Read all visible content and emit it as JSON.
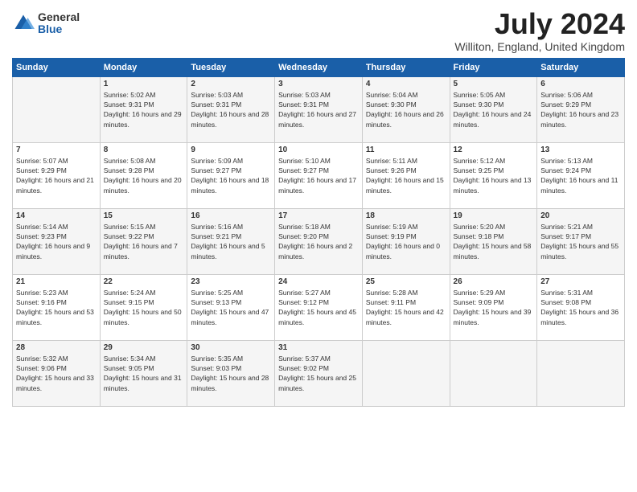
{
  "header": {
    "logo_general": "General",
    "logo_blue": "Blue",
    "month_title": "July 2024",
    "location": "Williton, England, United Kingdom"
  },
  "days_of_week": [
    "Sunday",
    "Monday",
    "Tuesday",
    "Wednesday",
    "Thursday",
    "Friday",
    "Saturday"
  ],
  "weeks": [
    [
      {
        "day": "",
        "sunrise": "",
        "sunset": "",
        "daylight": ""
      },
      {
        "day": "1",
        "sunrise": "Sunrise: 5:02 AM",
        "sunset": "Sunset: 9:31 PM",
        "daylight": "Daylight: 16 hours and 29 minutes."
      },
      {
        "day": "2",
        "sunrise": "Sunrise: 5:03 AM",
        "sunset": "Sunset: 9:31 PM",
        "daylight": "Daylight: 16 hours and 28 minutes."
      },
      {
        "day": "3",
        "sunrise": "Sunrise: 5:03 AM",
        "sunset": "Sunset: 9:31 PM",
        "daylight": "Daylight: 16 hours and 27 minutes."
      },
      {
        "day": "4",
        "sunrise": "Sunrise: 5:04 AM",
        "sunset": "Sunset: 9:30 PM",
        "daylight": "Daylight: 16 hours and 26 minutes."
      },
      {
        "day": "5",
        "sunrise": "Sunrise: 5:05 AM",
        "sunset": "Sunset: 9:30 PM",
        "daylight": "Daylight: 16 hours and 24 minutes."
      },
      {
        "day": "6",
        "sunrise": "Sunrise: 5:06 AM",
        "sunset": "Sunset: 9:29 PM",
        "daylight": "Daylight: 16 hours and 23 minutes."
      }
    ],
    [
      {
        "day": "7",
        "sunrise": "Sunrise: 5:07 AM",
        "sunset": "Sunset: 9:29 PM",
        "daylight": "Daylight: 16 hours and 21 minutes."
      },
      {
        "day": "8",
        "sunrise": "Sunrise: 5:08 AM",
        "sunset": "Sunset: 9:28 PM",
        "daylight": "Daylight: 16 hours and 20 minutes."
      },
      {
        "day": "9",
        "sunrise": "Sunrise: 5:09 AM",
        "sunset": "Sunset: 9:27 PM",
        "daylight": "Daylight: 16 hours and 18 minutes."
      },
      {
        "day": "10",
        "sunrise": "Sunrise: 5:10 AM",
        "sunset": "Sunset: 9:27 PM",
        "daylight": "Daylight: 16 hours and 17 minutes."
      },
      {
        "day": "11",
        "sunrise": "Sunrise: 5:11 AM",
        "sunset": "Sunset: 9:26 PM",
        "daylight": "Daylight: 16 hours and 15 minutes."
      },
      {
        "day": "12",
        "sunrise": "Sunrise: 5:12 AM",
        "sunset": "Sunset: 9:25 PM",
        "daylight": "Daylight: 16 hours and 13 minutes."
      },
      {
        "day": "13",
        "sunrise": "Sunrise: 5:13 AM",
        "sunset": "Sunset: 9:24 PM",
        "daylight": "Daylight: 16 hours and 11 minutes."
      }
    ],
    [
      {
        "day": "14",
        "sunrise": "Sunrise: 5:14 AM",
        "sunset": "Sunset: 9:23 PM",
        "daylight": "Daylight: 16 hours and 9 minutes."
      },
      {
        "day": "15",
        "sunrise": "Sunrise: 5:15 AM",
        "sunset": "Sunset: 9:22 PM",
        "daylight": "Daylight: 16 hours and 7 minutes."
      },
      {
        "day": "16",
        "sunrise": "Sunrise: 5:16 AM",
        "sunset": "Sunset: 9:21 PM",
        "daylight": "Daylight: 16 hours and 5 minutes."
      },
      {
        "day": "17",
        "sunrise": "Sunrise: 5:18 AM",
        "sunset": "Sunset: 9:20 PM",
        "daylight": "Daylight: 16 hours and 2 minutes."
      },
      {
        "day": "18",
        "sunrise": "Sunrise: 5:19 AM",
        "sunset": "Sunset: 9:19 PM",
        "daylight": "Daylight: 16 hours and 0 minutes."
      },
      {
        "day": "19",
        "sunrise": "Sunrise: 5:20 AM",
        "sunset": "Sunset: 9:18 PM",
        "daylight": "Daylight: 15 hours and 58 minutes."
      },
      {
        "day": "20",
        "sunrise": "Sunrise: 5:21 AM",
        "sunset": "Sunset: 9:17 PM",
        "daylight": "Daylight: 15 hours and 55 minutes."
      }
    ],
    [
      {
        "day": "21",
        "sunrise": "Sunrise: 5:23 AM",
        "sunset": "Sunset: 9:16 PM",
        "daylight": "Daylight: 15 hours and 53 minutes."
      },
      {
        "day": "22",
        "sunrise": "Sunrise: 5:24 AM",
        "sunset": "Sunset: 9:15 PM",
        "daylight": "Daylight: 15 hours and 50 minutes."
      },
      {
        "day": "23",
        "sunrise": "Sunrise: 5:25 AM",
        "sunset": "Sunset: 9:13 PM",
        "daylight": "Daylight: 15 hours and 47 minutes."
      },
      {
        "day": "24",
        "sunrise": "Sunrise: 5:27 AM",
        "sunset": "Sunset: 9:12 PM",
        "daylight": "Daylight: 15 hours and 45 minutes."
      },
      {
        "day": "25",
        "sunrise": "Sunrise: 5:28 AM",
        "sunset": "Sunset: 9:11 PM",
        "daylight": "Daylight: 15 hours and 42 minutes."
      },
      {
        "day": "26",
        "sunrise": "Sunrise: 5:29 AM",
        "sunset": "Sunset: 9:09 PM",
        "daylight": "Daylight: 15 hours and 39 minutes."
      },
      {
        "day": "27",
        "sunrise": "Sunrise: 5:31 AM",
        "sunset": "Sunset: 9:08 PM",
        "daylight": "Daylight: 15 hours and 36 minutes."
      }
    ],
    [
      {
        "day": "28",
        "sunrise": "Sunrise: 5:32 AM",
        "sunset": "Sunset: 9:06 PM",
        "daylight": "Daylight: 15 hours and 33 minutes."
      },
      {
        "day": "29",
        "sunrise": "Sunrise: 5:34 AM",
        "sunset": "Sunset: 9:05 PM",
        "daylight": "Daylight: 15 hours and 31 minutes."
      },
      {
        "day": "30",
        "sunrise": "Sunrise: 5:35 AM",
        "sunset": "Sunset: 9:03 PM",
        "daylight": "Daylight: 15 hours and 28 minutes."
      },
      {
        "day": "31",
        "sunrise": "Sunrise: 5:37 AM",
        "sunset": "Sunset: 9:02 PM",
        "daylight": "Daylight: 15 hours and 25 minutes."
      },
      {
        "day": "",
        "sunrise": "",
        "sunset": "",
        "daylight": ""
      },
      {
        "day": "",
        "sunrise": "",
        "sunset": "",
        "daylight": ""
      },
      {
        "day": "",
        "sunrise": "",
        "sunset": "",
        "daylight": ""
      }
    ]
  ]
}
